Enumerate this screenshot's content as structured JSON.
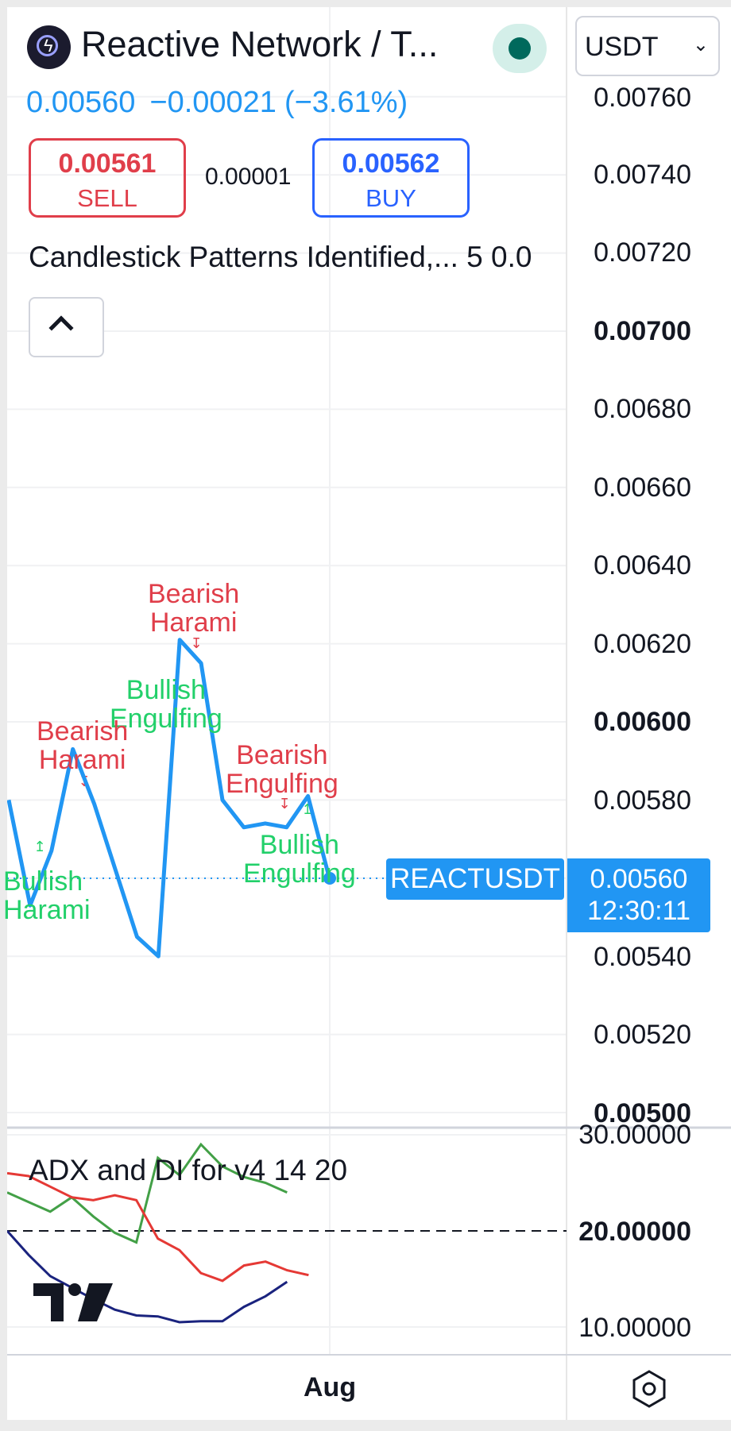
{
  "header": {
    "title": "Reactive Network / T...",
    "logo_icon": "reactive-network-logo-icon",
    "status": "market-open",
    "currency": "USDT"
  },
  "quote": {
    "last": "0.00560",
    "change": "−0.00021",
    "change_pct": "(−3.61%)"
  },
  "trade": {
    "sell_price": "0.00561",
    "sell_label": "SELL",
    "spread": "0.00001",
    "buy_price": "0.00562",
    "buy_label": "BUY"
  },
  "indicator": {
    "label": "Candlestick Patterns Identified,... 5 0.0"
  },
  "price_axis": {
    "ticks": [
      "0.00760",
      "0.00740",
      "0.00720",
      "0.00700",
      "0.00680",
      "0.00660",
      "0.00640",
      "0.00620",
      "0.00600",
      "0.00580",
      "0.00540",
      "0.00520",
      "0.00500"
    ],
    "bold_ticks": [
      "0.00700",
      "0.00600",
      "0.00500"
    ]
  },
  "patterns": [
    {
      "line1": "Bearish",
      "line2": "Harami",
      "kind": "bearish"
    },
    {
      "line1": "Bullish",
      "line2": "Engulfing",
      "kind": "bullish"
    },
    {
      "line1": "Bearish",
      "line2": "Harami",
      "kind": "bearish"
    },
    {
      "line1": "Bearish",
      "line2": "Engulfing",
      "kind": "bearish"
    },
    {
      "line1": "Bullish",
      "line2": "Engulfing",
      "kind": "bullish"
    },
    {
      "line1": "Bullish",
      "line2": "Harami",
      "kind": "bullish"
    }
  ],
  "symbol_tag": "REACTUSDT",
  "last_price_tag": {
    "price": "0.00560",
    "countdown": "12:30:11"
  },
  "adx": {
    "title": "ADX and DI for v4 14 20",
    "ticks": [
      "30.00000",
      "20.00000",
      "10.00000"
    ],
    "threshold": 20
  },
  "time_axis": {
    "label": "Aug"
  },
  "chart_data": [
    {
      "type": "line",
      "title": "",
      "ylim": [
        0.005,
        0.0076
      ],
      "y_axis_side": "right",
      "series": [
        {
          "color": "#2196f3",
          "values": [
            0.0058,
            0.00553,
            0.00567,
            0.00593,
            0.00579,
            0.00562,
            0.00545,
            0.0054,
            0.00621,
            0.00615,
            0.0058,
            0.00573,
            0.00574,
            0.00573,
            0.00581,
            0.0056
          ]
        }
      ],
      "last_price_line": 0.0056,
      "grid": true
    },
    {
      "type": "line",
      "title": "ADX and DI for v4 14 20",
      "ylim": [
        8,
        31
      ],
      "series": [
        {
          "color": "#43a047",
          "values": [
            24,
            23,
            22,
            23.5,
            21.5,
            19.8,
            18.8,
            27.6,
            25.8,
            29,
            26.7,
            25.6,
            25,
            24
          ]
        },
        {
          "color": "#e53935",
          "values": [
            26,
            25.7,
            24.6,
            23.5,
            23.2,
            23.7,
            23.2,
            19.2,
            18,
            15.6,
            14.8,
            16.4,
            16.8,
            15.9,
            15.4
          ]
        },
        {
          "color": "#1a237e",
          "values": [
            20,
            17.5,
            15.3,
            14.1,
            12.9,
            11.8,
            11.2,
            11.1,
            10.5,
            10.6,
            10.6,
            12.1,
            13.2,
            14.7
          ]
        }
      ],
      "threshold_line": 20,
      "grid": true
    }
  ]
}
